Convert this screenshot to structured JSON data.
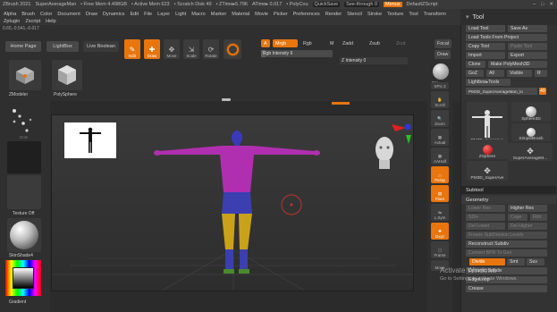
{
  "titlebar": {
    "app": "ZBrush 2021",
    "project": "SuperAverageMan",
    "free_mem": "• Free Mem 4.498GB",
    "active_mem": "• Active Mem 623",
    "scratch": "• Scratch Disk 49",
    "ztime": "• ZTime▸5.796",
    "atime": "ATime▸ 0.017",
    "polycount": "• PolyCou",
    "quicksave": "QuickSave",
    "see_through": "See-through  0",
    "menus": "Menus",
    "default_script": "DefaultZScript"
  },
  "menubar": [
    "Alpha",
    "Brush",
    "Color",
    "Document",
    "Draw",
    "Dynamics",
    "Edit",
    "File",
    "Layer",
    "Light",
    "Macro",
    "Marker",
    "Material",
    "Movie",
    "Picker",
    "Preferences",
    "Render",
    "Stencil",
    "Stroke",
    "Texture",
    "Tool",
    "Transform",
    "Zplugin",
    "Zscript",
    "Help"
  ],
  "coords": "0.65,-0.541,-0.017",
  "shelf": {
    "home_page": "Home Page",
    "lightbox": "LightBox",
    "live_boolean": "Live Boolean",
    "edit": "Edit",
    "draw": "Draw",
    "move": "Move",
    "scale": "Scale",
    "rotate": "Rotate",
    "a": "A",
    "mrgb": "Mrgb",
    "rgb": "Rgb",
    "m": "M",
    "zadd": "Zadd",
    "zsub": "Zsub",
    "zcut": "Zcut",
    "rgb_intensity_label": "Rgb Intensity 6",
    "rgb_intensity_value": 0.06,
    "z_intensity_label": "Z Intensity 0",
    "z_intensity_value": 0,
    "focal": "Focal",
    "draw_size": "Draw"
  },
  "left": {
    "zmodeler": "ZModeler",
    "polysphere": "PolySphere",
    "dots": "Dots",
    "texture_off": "Texture Off",
    "material": "SkinShade4",
    "gradient": "Gradient"
  },
  "rshelf": [
    "Bpr",
    "SPix 3",
    "Scroll",
    "Zoom",
    "Actual",
    "AAHalf",
    "Persp",
    "Floor",
    "L.Sym",
    "Gxyz",
    "Frame",
    "Move"
  ],
  "tool": {
    "title": "Tool",
    "load_tool": "Load Tool",
    "save_as": "Save As",
    "load_from_project": "Load Tools From Project",
    "copy_tool": "Copy Tool",
    "paste_tool": "Paste Tool",
    "import": "Import",
    "export": "Export",
    "clone": "Clone",
    "make_polymesh": "Make PolyMesh3D",
    "goz": "GoZ",
    "all": "All",
    "visible": "Visible",
    "r": "R",
    "lightbox_tools": "Lightbox▸Tools",
    "current_tool": "PM3D_SuperAverageMan_lo",
    "current_tool_value": "49",
    "thumbs": [
      "PM3D_SuperAve",
      "Sphere3D",
      "ZSphere",
      "SimpleBrush",
      "SuperAverageM...",
      "PM3D_SuperAve"
    ],
    "subtool": "Subtool",
    "geometry": "Geometry",
    "lower_res": "Lower Res",
    "higher_res": "Higher Res",
    "sdiv": "SDiv",
    "cage": "Cage",
    "rstr": "Rstr",
    "del_lower": "Del Lower",
    "del_higher": "Del Higher",
    "freeze_subdiv": "Freeze SubDivision Levels",
    "reconstruct_subdiv": "Reconstruct Subdiv",
    "convert_bpr": "Convert BPR To Geo",
    "divide": "Divide",
    "smt": "Smt",
    "suv": "Suv",
    "dynamic_subdiv": "Dynamic Subdiv",
    "edgeloop": "EdgeLoop",
    "crease": "Crease"
  },
  "watermark": {
    "line1": "Activate Windows",
    "line2": "Go to Settings to activate Windows."
  },
  "colors": {
    "accent": "#e8750d",
    "torso": "#b02fb0",
    "legs": "#c9a21a",
    "boots": "#3b3fb0",
    "head": "#3a3ab8"
  }
}
